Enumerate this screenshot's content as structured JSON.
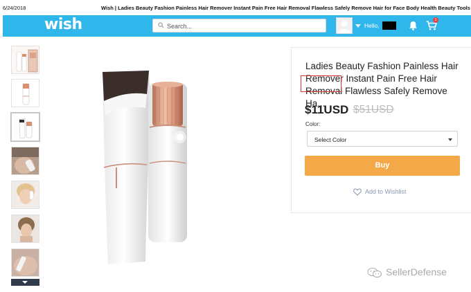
{
  "print_header": {
    "date": "6/24/2018",
    "title": "Wish | Ladies Beauty Fashion Painless Hair Remover Instant Pain Free Hair Removal Flawless Safely Remove Hair for Face Body Health Beauty Tools"
  },
  "navbar": {
    "logo": "wish",
    "search_placeholder": "Search...",
    "greeting": "Hello,",
    "cart_count": "1",
    "bar_color": "#2fb7ec"
  },
  "product": {
    "title": "Ladies Beauty Fashion Painless Hair Remover Instant Pain Free Hair Removal Flawless Safely Remove Ha...",
    "highlighted_word": "Flawless",
    "price": "$11USD",
    "original_price": "$51USD",
    "color_label": "Color:",
    "color_select_value": "Select Color",
    "buy_label": "Buy",
    "wishlist_label": "Add to Wishlist",
    "buy_color": "#f4a948",
    "highlight_color": "#d8342e"
  },
  "thumbnails": [
    {
      "icon": "product-with-box-thumbnail"
    },
    {
      "icon": "product-single-thumbnail"
    },
    {
      "icon": "product-duo-thumbnail"
    },
    {
      "icon": "face-use-thumbnail"
    },
    {
      "icon": "model-face-thumbnail"
    },
    {
      "icon": "model-face-thumbnail"
    },
    {
      "icon": "product-in-hand-thumbnail"
    }
  ],
  "watermark": {
    "text": "SellerDefense"
  }
}
